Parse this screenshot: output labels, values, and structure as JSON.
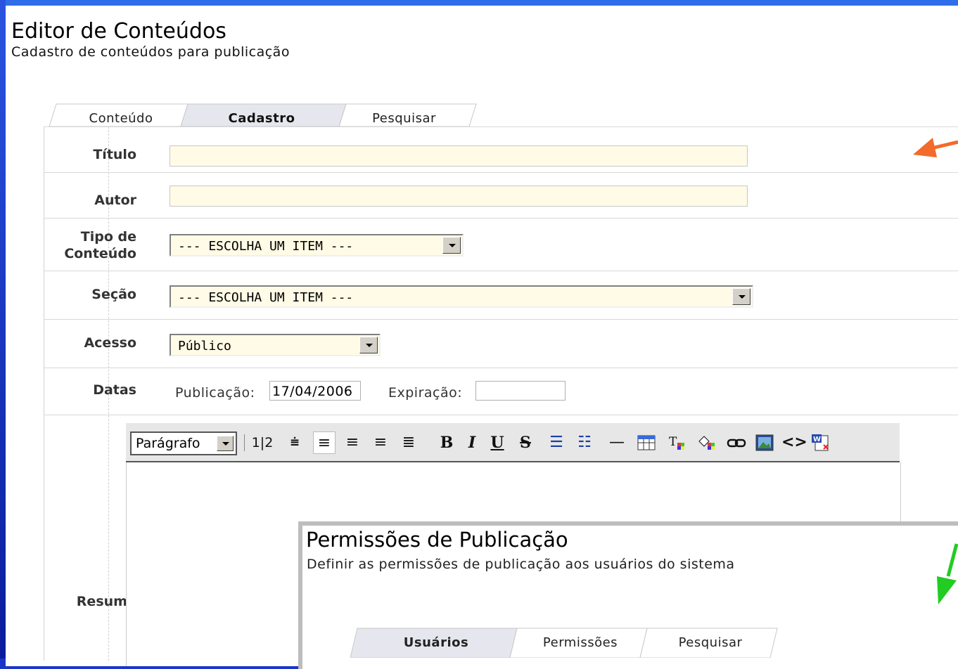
{
  "header": {
    "title": "Editor de Conteúdos",
    "subtitle": "Cadastro de conteúdos para publicação"
  },
  "tabs": [
    {
      "label": "Conteúdo",
      "active": false
    },
    {
      "label": "Cadastro",
      "active": true
    },
    {
      "label": "Pesquisar",
      "active": false
    }
  ],
  "form": {
    "titulo_label": "Título",
    "autor_label": "Autor",
    "tipo_label_1": "Tipo de",
    "tipo_label_2": "Conteúdo",
    "tipo_value": "--- ESCOLHA UM ITEM ---",
    "secao_label": "Seção",
    "secao_value": "--- ESCOLHA UM ITEM ---",
    "acesso_label": "Acesso",
    "acesso_value": "Público",
    "datas_label": "Datas",
    "publicacao_label": "Publicação:",
    "publicacao_value": "17/04/2006",
    "expiracao_label": "Expiração:",
    "expiracao_value": "",
    "resumo_label": "Resumo"
  },
  "editor": {
    "format_value": "Parágrafo",
    "icons": [
      "ordered-text-icon",
      "horizontal-rule-double-icon",
      "align-left-icon",
      "align-center-icon",
      "align-right-icon",
      "align-justify-icon",
      "bold-icon",
      "italic-icon",
      "underline-icon",
      "strikethrough-icon",
      "ordered-list-icon",
      "unordered-list-icon",
      "horizontal-rule-icon",
      "table-icon",
      "text-color-icon",
      "background-color-icon",
      "link-icon",
      "image-icon",
      "html-source-icon",
      "word-paste-icon"
    ]
  },
  "overlay": {
    "title": "Permissões de Publicação",
    "subtitle": "Definir as permissões de publicação aos usuários do sistema",
    "tabs": [
      {
        "label": "Usuários",
        "active": true
      },
      {
        "label": "Permissões",
        "active": false
      },
      {
        "label": "Pesquisar",
        "active": false
      }
    ]
  },
  "colors": {
    "background": "#1a36c8",
    "field_bg": "#fffbe6",
    "active_tab": "#e6e6ee",
    "arrow_orange": "#f46a2a",
    "arrow_green": "#22cc22"
  }
}
